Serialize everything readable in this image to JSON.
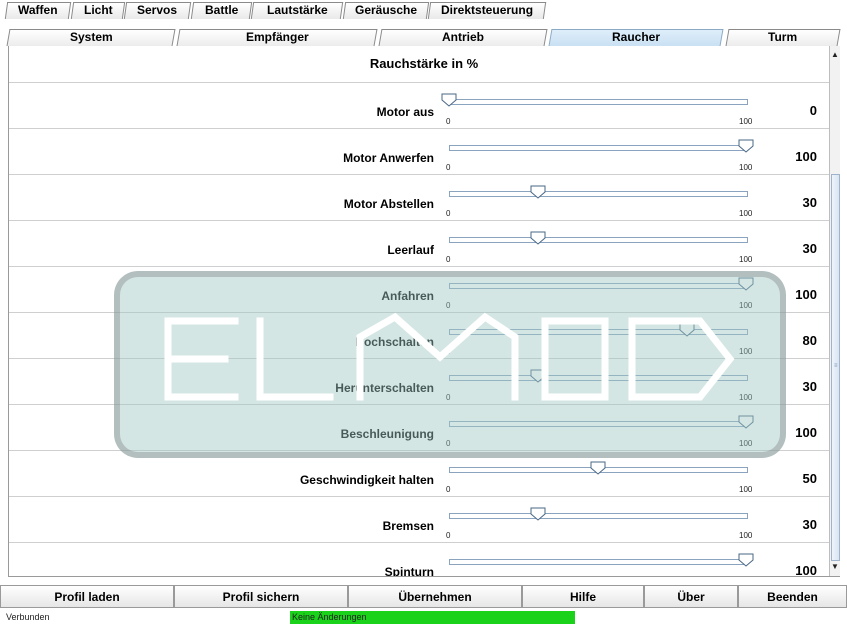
{
  "tabs_row1": [
    "Waffen",
    "Licht",
    "Servos",
    "Battle",
    "Lautstärke",
    "Geräusche",
    "Direktsteuerung"
  ],
  "tabs_row2": [
    "System",
    "Empfänger",
    "Antrieb",
    "Raucher",
    "Turm"
  ],
  "active_tab": "Raucher",
  "accent_color": "#c9e0f3",
  "heading": "Rauchstärke in %",
  "slider_min_label": "0",
  "slider_max_label": "100",
  "rows": [
    {
      "label": "Motor aus",
      "value": "0",
      "level": 0
    },
    {
      "label": "Motor Anwerfen",
      "value": "100",
      "level": 100
    },
    {
      "label": "Motor Abstellen",
      "value": "30",
      "level": 30
    },
    {
      "label": "Leerlauf",
      "value": "30",
      "level": 30
    },
    {
      "label": "Anfahren",
      "value": "100",
      "level": 100
    },
    {
      "label": "Hochschalten",
      "value": "80",
      "level": 80
    },
    {
      "label": "Herunterschalten",
      "value": "30",
      "level": 30
    },
    {
      "label": "Beschleunigung",
      "value": "100",
      "level": 100
    },
    {
      "label": "Geschwindigkeit halten",
      "value": "50",
      "level": 50
    },
    {
      "label": "Bremsen",
      "value": "30",
      "level": 30
    },
    {
      "label": "Spinturn",
      "value": "100",
      "level": 100
    }
  ],
  "buttons": [
    "Profil laden",
    "Profil sichern",
    "Übernehmen",
    "Hilfe",
    "Über",
    "Beenden"
  ],
  "status": {
    "connection": "Verbunden",
    "changes": "Keine Änderungen",
    "changes_color": "#19d219"
  }
}
